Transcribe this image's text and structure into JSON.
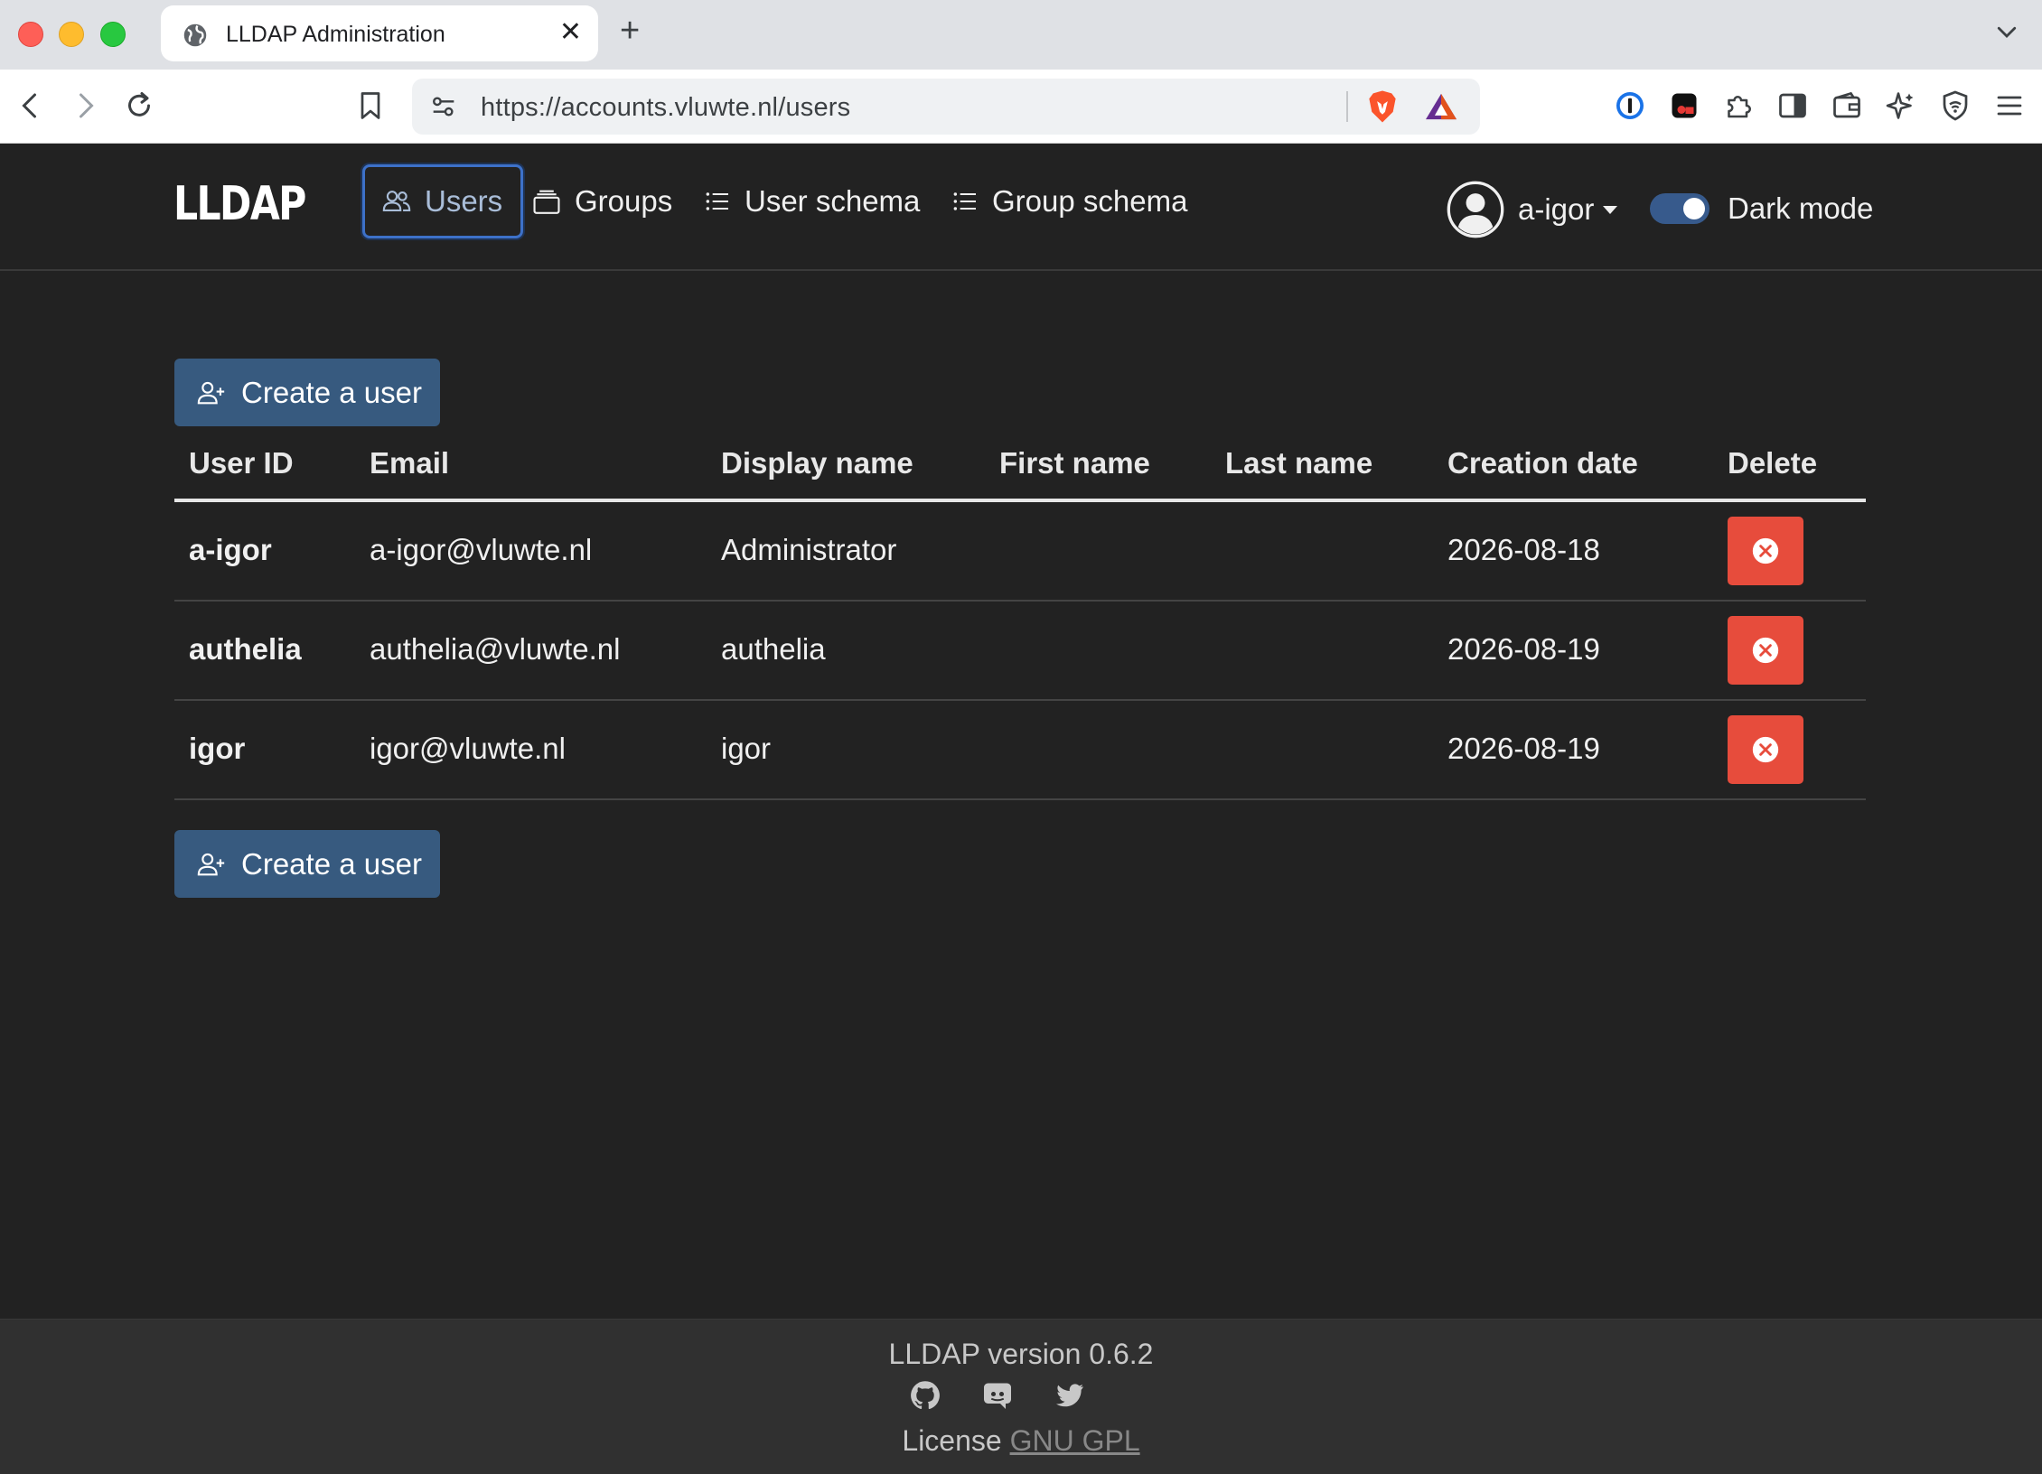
{
  "browser": {
    "tab_title": "LLDAP Administration",
    "url": "https://accounts.vluwte.nl/users"
  },
  "app": {
    "brand": "LLDAP",
    "nav": {
      "users": "Users",
      "groups": "Groups",
      "user_schema": "User schema",
      "group_schema": "Group schema"
    },
    "user_menu": "a-igor",
    "dark_mode_label": "Dark mode",
    "dark_mode_on": true
  },
  "content": {
    "create_user_label": "Create a user",
    "table": {
      "headers": {
        "user_id": "User ID",
        "email": "Email",
        "display_name": "Display name",
        "first_name": "First name",
        "last_name": "Last name",
        "creation_date": "Creation date",
        "delete": "Delete"
      },
      "rows": [
        {
          "user_id": "a-igor",
          "email": "a-igor@vluwte.nl",
          "display_name": "Administrator",
          "first_name": "",
          "last_name": "",
          "creation_date": "2026-08-18"
        },
        {
          "user_id": "authelia",
          "email": "authelia@vluwte.nl",
          "display_name": "authelia",
          "first_name": "",
          "last_name": "",
          "creation_date": "2026-08-19"
        },
        {
          "user_id": "igor",
          "email": "igor@vluwte.nl",
          "display_name": "igor",
          "first_name": "",
          "last_name": "",
          "creation_date": "2026-08-19"
        }
      ]
    }
  },
  "footer": {
    "version": "LLDAP version 0.6.2",
    "license_prefix": "License",
    "license_link": "GNU GPL",
    "icons": [
      "github-icon",
      "discord-icon",
      "twitter-icon"
    ]
  },
  "colors": {
    "background": "#222222",
    "primary": "#375a7f",
    "danger": "#e74c3c",
    "footer": "#303030"
  }
}
